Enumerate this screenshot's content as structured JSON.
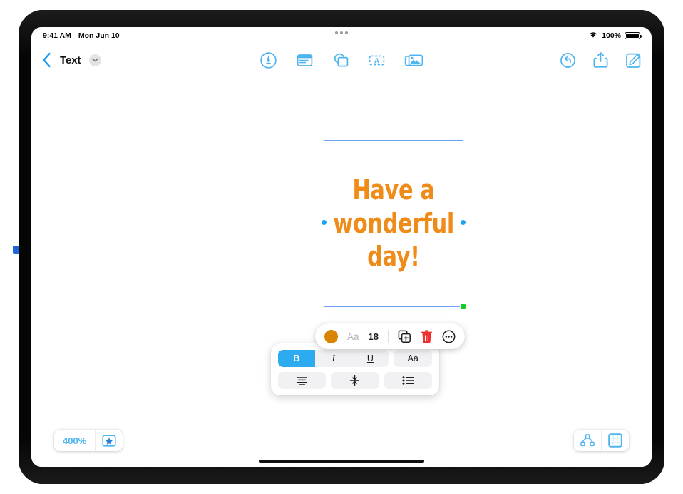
{
  "status_bar": {
    "time": "9:41 AM",
    "date": "Mon Jun 10",
    "battery_percent": "100%",
    "wifi_icon": "wifi-icon",
    "battery_icon": "battery-full-icon",
    "multitask_icon": "multitask-dots-icon"
  },
  "nav_bar": {
    "back_icon": "chevron-left-icon",
    "title": "Text",
    "title_chevron_icon": "chevron-down-icon",
    "center_tools": [
      {
        "name": "pen-markup-icon",
        "label": "Markup"
      },
      {
        "name": "note-icon",
        "label": "Note"
      },
      {
        "name": "shapes-icon",
        "label": "Shapes"
      },
      {
        "name": "text-box-icon",
        "label": "Text Box"
      },
      {
        "name": "media-icon",
        "label": "Media"
      }
    ],
    "right_tools": [
      {
        "name": "undo-icon",
        "label": "Undo"
      },
      {
        "name": "share-icon",
        "label": "Share"
      },
      {
        "name": "compose-icon",
        "label": "Compose"
      }
    ]
  },
  "canvas": {
    "textbox": {
      "lines": [
        "Have a",
        "wonderful",
        "day!"
      ],
      "text_color": "#ef8b18",
      "selection_border_color": "#6f9ff0",
      "handle_color": "#1aa3f0",
      "resize_handle_color": "#14cc2b"
    }
  },
  "format_pill": {
    "color_swatch": "#d98500",
    "font_label": "Aa",
    "font_size": "18",
    "duplicate_icon": "duplicate-icon",
    "delete_icon": "trash-icon",
    "more_icon": "more-circle-icon"
  },
  "format_panel": {
    "row1": [
      {
        "name": "bold-button",
        "label": "B",
        "active": true
      },
      {
        "name": "italic-button",
        "label": "I",
        "active": false
      },
      {
        "name": "underline-button",
        "label": "U",
        "active": false
      },
      {
        "name": "font-style-button",
        "label": "Aa",
        "active": false
      }
    ],
    "row2": [
      {
        "name": "text-align-icon",
        "label": "Align"
      },
      {
        "name": "vertical-align-icon",
        "label": "Vertical Align"
      },
      {
        "name": "bullet-list-icon",
        "label": "List"
      }
    ],
    "accent_color": "#2cabf0"
  },
  "bottom_bar": {
    "zoom_level": "400%",
    "star_icon": "star-box-icon",
    "connections_icon": "node-connections-icon",
    "canvas_icon": "canvas-grid-icon",
    "home_indicator": "home-indicator"
  }
}
